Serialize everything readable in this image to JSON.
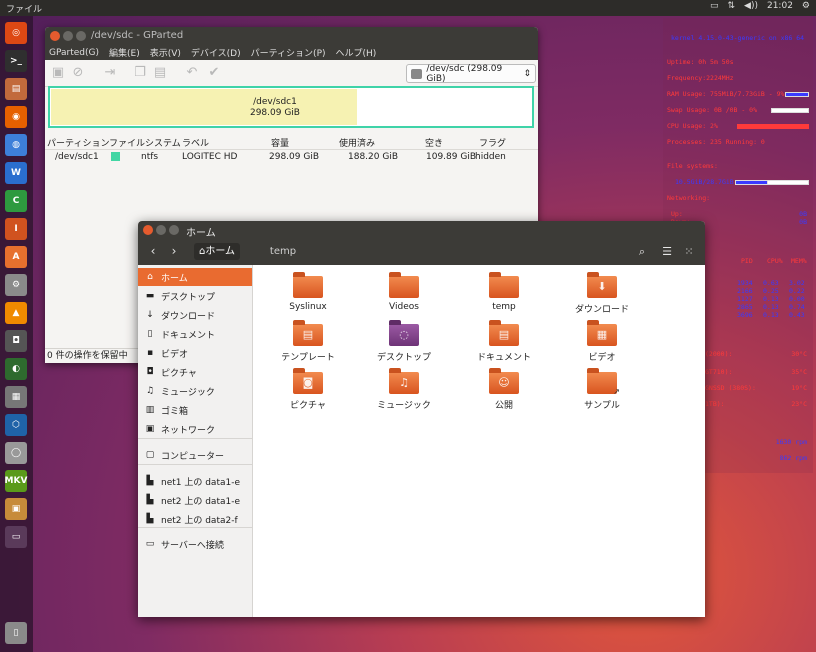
{
  "top_panel": {
    "menu": "ファイル",
    "clock": "21:02"
  },
  "launcher": [
    {
      "name": "ubuntu-dash-icon",
      "glyph": "◎",
      "color": "#dd4814"
    },
    {
      "name": "terminal-icon",
      "glyph": ">_",
      "color": "#2f2f2f"
    },
    {
      "name": "files-icon",
      "glyph": "▤",
      "color": "#c26a3c"
    },
    {
      "name": "firefox-icon",
      "glyph": "◉",
      "color": "#e66000"
    },
    {
      "name": "chromium-icon",
      "glyph": "◍",
      "color": "#3d7fd9"
    },
    {
      "name": "writer-icon",
      "glyph": "W",
      "color": "#2a6ecf"
    },
    {
      "name": "calc-icon",
      "glyph": "C",
      "color": "#2e9a3f"
    },
    {
      "name": "impress-icon",
      "glyph": "I",
      "color": "#d0521f"
    },
    {
      "name": "software-center-icon",
      "glyph": "A",
      "color": "#e7702e"
    },
    {
      "name": "settings-icon",
      "glyph": "⚙",
      "color": "#8a8a8a"
    },
    {
      "name": "vlc-icon",
      "glyph": "▲",
      "color": "#f08a00"
    },
    {
      "name": "camera-icon",
      "glyph": "◘",
      "color": "#555"
    },
    {
      "name": "globe-icon",
      "glyph": "◐",
      "color": "#2e6a2e"
    },
    {
      "name": "chess-icon",
      "glyph": "▦",
      "color": "#777"
    },
    {
      "name": "virtualbox-icon",
      "glyph": "⬡",
      "color": "#1f63a8"
    },
    {
      "name": "disc-icon",
      "glyph": "◯",
      "color": "#999"
    },
    {
      "name": "mkv-icon",
      "glyph": "MKV",
      "color": "#5a9a1a"
    },
    {
      "name": "photos-icon",
      "glyph": "▣",
      "color": "#c78b3a"
    },
    {
      "name": "workspace-icon",
      "glyph": "▭",
      "color": "#5a3a5a"
    },
    {
      "name": "trash-icon",
      "glyph": "▯",
      "color": "#8a8a8a"
    }
  ],
  "conky": {
    "kernel": "kernel 4.15.0-43-generic on x86 64",
    "uptime": "Uptime: 0h 5m 50s",
    "frequency": "Frequency:2224MHz",
    "ram": "RAM Usage: 755MiB/7.73GiB - 9%",
    "swap": "Swap Usage: 0B /0B  - 0%",
    "cpu": "CPU Usage: 2%",
    "processes": "Processes: 235  Running: 0",
    "file_systems": "File systems:",
    "fs_value": "10.5GiB/28.7GiB",
    "networking": "Networking:",
    "net_up_label": "Up:",
    "net_down_label": "Down:",
    "net_up": "0B",
    "net_down": "0B",
    "top_headers": [
      "PID",
      "CPU%",
      "MEM%"
    ],
    "top_rows": [
      {
        "name": "",
        "pid": "",
        "cpu": "",
        "mem": ""
      },
      {
        "name": "",
        "pid": "1934",
        "cpu": "0.63",
        "mem": "3.02"
      },
      {
        "name": "",
        "pid": "2166",
        "cpu": "0.25",
        "mem": "0.22"
      },
      {
        "name": "dia",
        "pid": "1127",
        "cpu": "0.13",
        "mem": "0.00"
      },
      {
        "name": "",
        "pid": "2865",
        "cpu": "0.13",
        "mem": "0.74"
      },
      {
        "name": "enshu",
        "pid": "3696",
        "cpu": "0.13",
        "mem": "0.43"
      }
    ],
    "temps": [
      {
        "label": "(2000):",
        "value": "30°C"
      },
      {
        "label": "GT710):",
        "value": "35°C"
      },
      {
        "label": "GNSSD (380S):",
        "value": "19°C"
      },
      {
        "label": "1TB):",
        "value": "23°C"
      }
    ],
    "fans": [
      "1630 rpm",
      "862 rpm"
    ]
  },
  "gparted": {
    "title": "/dev/sdc - GParted",
    "menu": [
      "GParted(G)",
      "編集(E)",
      "表示(V)",
      "デバイス(D)",
      "パーティション(P)",
      "ヘルプ(H)"
    ],
    "device": "/dev/sdc   (298.09 GiB)",
    "diskmap": {
      "line1": "/dev/sdc1",
      "line2": "298.09 GiB"
    },
    "columns": [
      "パーティション",
      "ファイルシステム",
      "ラベル",
      "容量",
      "使用済み",
      "空き",
      "フラグ"
    ],
    "rows": [
      {
        "partition": "/dev/sdc1",
        "fs": "ntfs",
        "label": "LOGITEC HD",
        "size": "298.09 GiB",
        "used": "188.20 GiB",
        "free": "109.89 GiB",
        "flags": "hidden"
      }
    ],
    "status": "0 件の操作を保留中",
    "colors": {
      "ntfs": "#42d6a4",
      "border": "#3fd3a8"
    }
  },
  "nautilus": {
    "title": "ホーム",
    "crumb_home": "ホーム",
    "crumb_temp": "temp",
    "sidebar": [
      {
        "label": "ホーム",
        "icon": "⌂",
        "name": "sidebar-item-home",
        "active": true
      },
      {
        "label": "デスクトップ",
        "icon": "▬",
        "name": "sidebar-item-desktop"
      },
      {
        "label": "ダウンロード",
        "icon": "↓",
        "name": "sidebar-item-downloads"
      },
      {
        "label": "ドキュメント",
        "icon": "▯",
        "name": "sidebar-item-documents"
      },
      {
        "label": "ビデオ",
        "icon": "▪",
        "name": "sidebar-item-videos"
      },
      {
        "label": "ピクチャ",
        "icon": "◘",
        "name": "sidebar-item-pictures"
      },
      {
        "label": "ミュージック",
        "icon": "♫",
        "name": "sidebar-item-music"
      },
      {
        "label": "ゴミ箱",
        "icon": "▥",
        "name": "sidebar-item-trash"
      },
      {
        "label": "ネットワーク",
        "icon": "▣",
        "name": "sidebar-item-network"
      },
      {
        "label": "コンピューター",
        "icon": "▢",
        "name": "sidebar-item-computer"
      },
      {
        "label": "net1 上の data1-e",
        "icon": "▙",
        "name": "sidebar-item-net1-data1"
      },
      {
        "label": "net2 上の data1-e",
        "icon": "▙",
        "name": "sidebar-item-net2-data1"
      },
      {
        "label": "net2 上の data2-f",
        "icon": "▙",
        "name": "sidebar-item-net2-data2"
      },
      {
        "label": "サーバーへ接続",
        "icon": "▭",
        "name": "sidebar-item-connect-server"
      }
    ],
    "files": [
      {
        "label": "Syslinux",
        "glyph": "",
        "name": "folder-syslinux"
      },
      {
        "label": "Videos",
        "glyph": "",
        "name": "folder-videos"
      },
      {
        "label": "temp",
        "glyph": "",
        "name": "folder-temp"
      },
      {
        "label": "ダウンロード",
        "glyph": "⬇",
        "name": "folder-downloads"
      },
      {
        "label": "テンプレート",
        "glyph": "▤",
        "name": "folder-templates"
      },
      {
        "label": "デスクトップ",
        "glyph": "◌",
        "name": "folder-desktop",
        "purple": true
      },
      {
        "label": "ドキュメント",
        "glyph": "▤",
        "name": "folder-documents"
      },
      {
        "label": "ビデオ",
        "glyph": "▦",
        "name": "folder-video"
      },
      {
        "label": "ピクチャ",
        "glyph": "◙",
        "name": "folder-pictures"
      },
      {
        "label": "ミュージック",
        "glyph": "♫",
        "name": "folder-music"
      },
      {
        "label": "公開",
        "glyph": "☺",
        "name": "folder-public"
      },
      {
        "label": "サンプル",
        "glyph": "",
        "name": "folder-samples",
        "badge": "↗"
      }
    ]
  }
}
